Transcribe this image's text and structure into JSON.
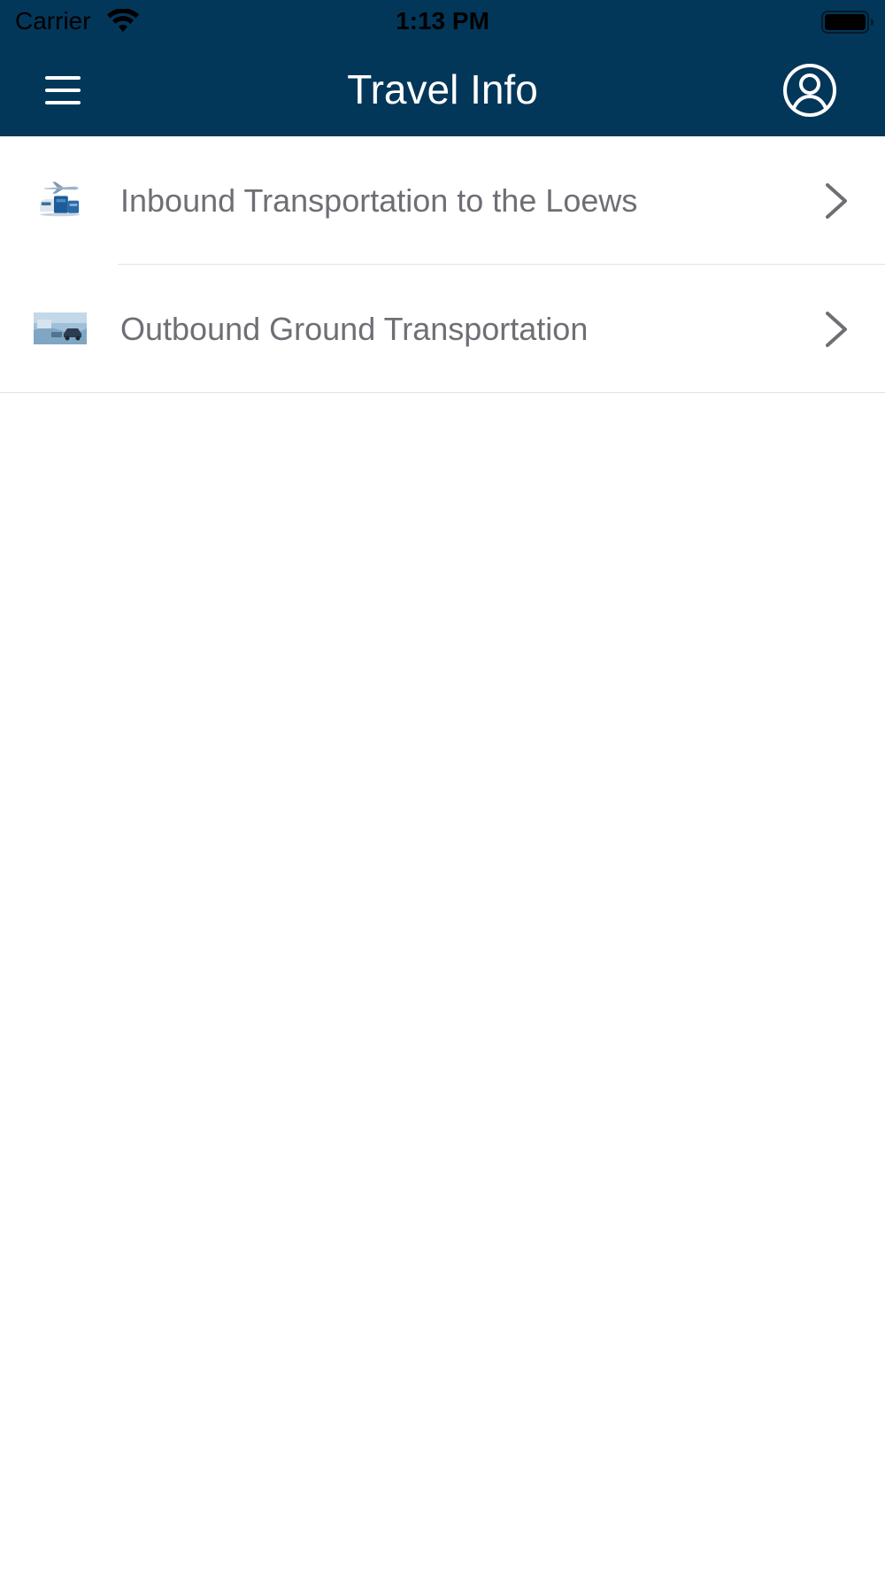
{
  "status_bar": {
    "carrier": "Carrier",
    "time": "1:13 PM",
    "wifi_icon": "wifi-icon",
    "battery_icon": "battery-full-icon"
  },
  "nav": {
    "title": "Travel Info",
    "menu_icon": "hamburger-menu-icon",
    "profile_icon": "user-circle-icon"
  },
  "items": [
    {
      "label": "Inbound Transportation to the Loews",
      "thumbnail": "airplane-transport-thumbnail",
      "accessory_icon": "chevron-right-icon"
    },
    {
      "label": "Outbound Ground Transportation",
      "thumbnail": "ground-transport-thumbnail",
      "accessory_icon": "chevron-right-icon"
    }
  ],
  "colors": {
    "header_background": "#03375a",
    "title_text": "#ffffff",
    "row_text": "#6e6f75",
    "divider": "#e2e2e4",
    "chevron": "#6e6f75"
  }
}
